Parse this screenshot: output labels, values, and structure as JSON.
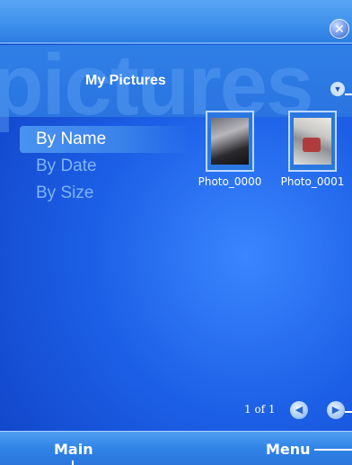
{
  "window": {
    "close_glyph": "✕"
  },
  "header": {
    "title": "My Pictures",
    "background_word": "pictures"
  },
  "sort_menu": {
    "items": [
      {
        "label": "By Name",
        "selected": true
      },
      {
        "label": "By Date",
        "selected": false
      },
      {
        "label": "By Size",
        "selected": false
      }
    ]
  },
  "thumbnails": [
    {
      "label": "Photo_0000"
    },
    {
      "label": "Photo_0001"
    }
  ],
  "pager": {
    "text": "1 of 1",
    "prev_glyph": "◀",
    "next_glyph": "▶"
  },
  "softkeys": {
    "left": "Main",
    "right": "Menu"
  },
  "colors": {
    "accent": "#1c5fe6",
    "selected_bg": "#4a92f0",
    "unselected_text": "#7fb4f7"
  }
}
